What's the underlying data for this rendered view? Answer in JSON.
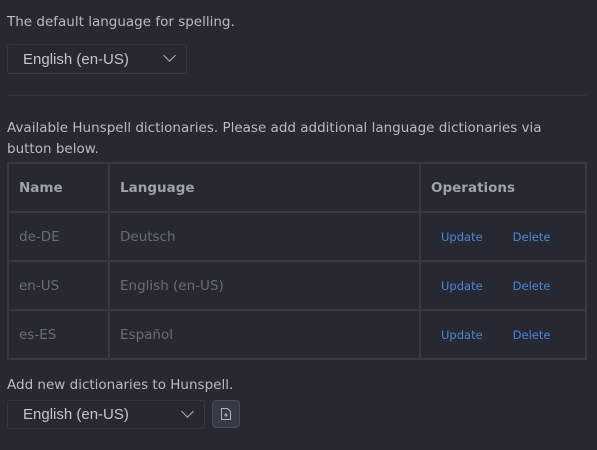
{
  "default_language": {
    "label": "The default language for spelling.",
    "selected": "English (en-US)"
  },
  "dictionaries": {
    "label": "Available Hunspell dictionaries. Please add additional language dictionaries via button below.",
    "columns": [
      "Name",
      "Language",
      "Operations"
    ],
    "rows": [
      {
        "name": "de-DE",
        "language": "Deutsch",
        "update": "Update",
        "delete": "Delete"
      },
      {
        "name": "en-US",
        "language": "English (en-US)",
        "update": "Update",
        "delete": "Delete"
      },
      {
        "name": "es-ES",
        "language": "Español",
        "update": "Update",
        "delete": "Delete"
      }
    ]
  },
  "add_dictionary": {
    "label": "Add new dictionaries to Hunspell.",
    "selected": "English (en-US)",
    "button_icon": "file-plus-icon"
  }
}
